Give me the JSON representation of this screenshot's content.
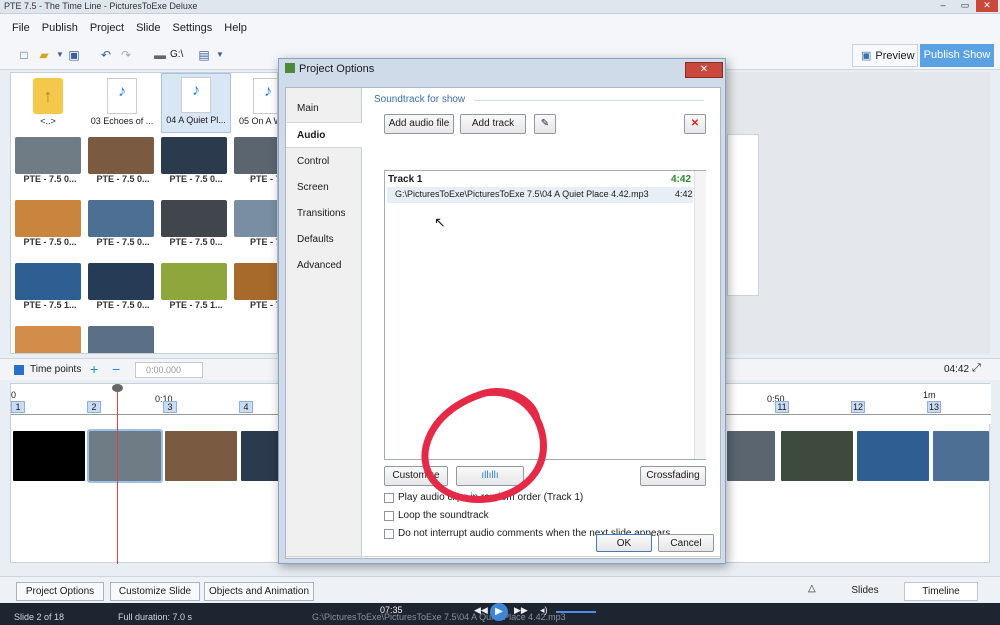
{
  "window": {
    "title": "PTE 7.5 - The Time Line - PicturesToExe Deluxe"
  },
  "menu": [
    "File",
    "Publish",
    "Project",
    "Slide",
    "Settings",
    "Help"
  ],
  "toolbar": {
    "drive_label": "G:\\",
    "preview_label": "Preview",
    "publish_label": "Publish Show"
  },
  "browser": {
    "files": [
      {
        "label": "<..>",
        "icon": "folder-up-icon"
      },
      {
        "label": "03 Echoes of ...",
        "icon": "mp3-icon"
      },
      {
        "label": "04 A Quiet Pl...",
        "icon": "mp3-icon",
        "selected": true
      },
      {
        "label": "05 On A W",
        "icon": "mp3-icon"
      }
    ],
    "thumbs": [
      {
        "label": "PTE - 7.5   0...",
        "color": "#6f7b85"
      },
      {
        "label": "PTE - 7.5   0...",
        "color": "#7a5a40"
      },
      {
        "label": "PTE - 7.5   0...",
        "color": "#2c3a4e"
      },
      {
        "label": "PTE - 7.5",
        "color": "#5a6570"
      },
      {
        "label": "PTE - 7.5   0...",
        "color": "#c9843e"
      },
      {
        "label": "PTE - 7.5   0...",
        "color": "#4d6f93"
      },
      {
        "label": "PTE - 7.5   0...",
        "color": "#40464c"
      },
      {
        "label": "PTE - 7.5",
        "color": "#7a8ea3"
      },
      {
        "label": "PTE - 7.5   1...",
        "color": "#2f5e92"
      },
      {
        "label": "PTE - 7.5   0...",
        "color": "#263b55"
      },
      {
        "label": "PTE - 7.5   1...",
        "color": "#8fa63c"
      },
      {
        "label": "PTE - 7.5",
        "color": "#a86a2a"
      },
      {
        "label": "",
        "color": "#d38d4a"
      },
      {
        "label": "",
        "color": "#5b6f86"
      }
    ]
  },
  "timepoints": {
    "label": "Time points",
    "time_value": "0:00.000",
    "duration": "04:42"
  },
  "timeline": {
    "ruler_labels": [
      "0",
      "0:10",
      "0:50",
      "1m"
    ],
    "markers": [
      "1",
      "2",
      "3",
      "4",
      "11",
      "12",
      "13"
    ]
  },
  "bottom": {
    "project_options": "Project Options",
    "customize_slide": "Customize Slide",
    "objects_animation": "Objects and Animation",
    "tab_slides": "Slides",
    "tab_timeline": "Timeline"
  },
  "status": {
    "slide": "Slide 2 of 18",
    "duration": "Full duration: 7.0 s",
    "path": "G:\\PicturesToExe\\PicturesToExe 7.5\\04 A Quiet Place 4.42.mp3",
    "player_time": "07:35"
  },
  "dialog": {
    "title": "Project Options",
    "nav": [
      "Main",
      "Audio",
      "Control",
      "Screen",
      "Transitions",
      "Defaults",
      "Advanced"
    ],
    "active_nav": "Audio",
    "section_title": "Soundtrack for show",
    "add_audio_label": "Add audio file",
    "add_track_label": "Add track",
    "track_name": "Track 1",
    "track_total": "4:42",
    "track_file": "G:\\PicturesToExe\\PicturesToExe 7.5\\04 A Quiet Place 4.42.mp3",
    "track_file_duration": "4:42",
    "customize_label": "Customize",
    "crossfading_label": "Crossfading",
    "opt_random": "Play audio clips in random order (Track 1)",
    "opt_loop": "Loop the soundtrack",
    "opt_no_interrupt": "Do not interrupt audio comments when the next slide appears",
    "ok_label": "OK",
    "cancel_label": "Cancel"
  }
}
